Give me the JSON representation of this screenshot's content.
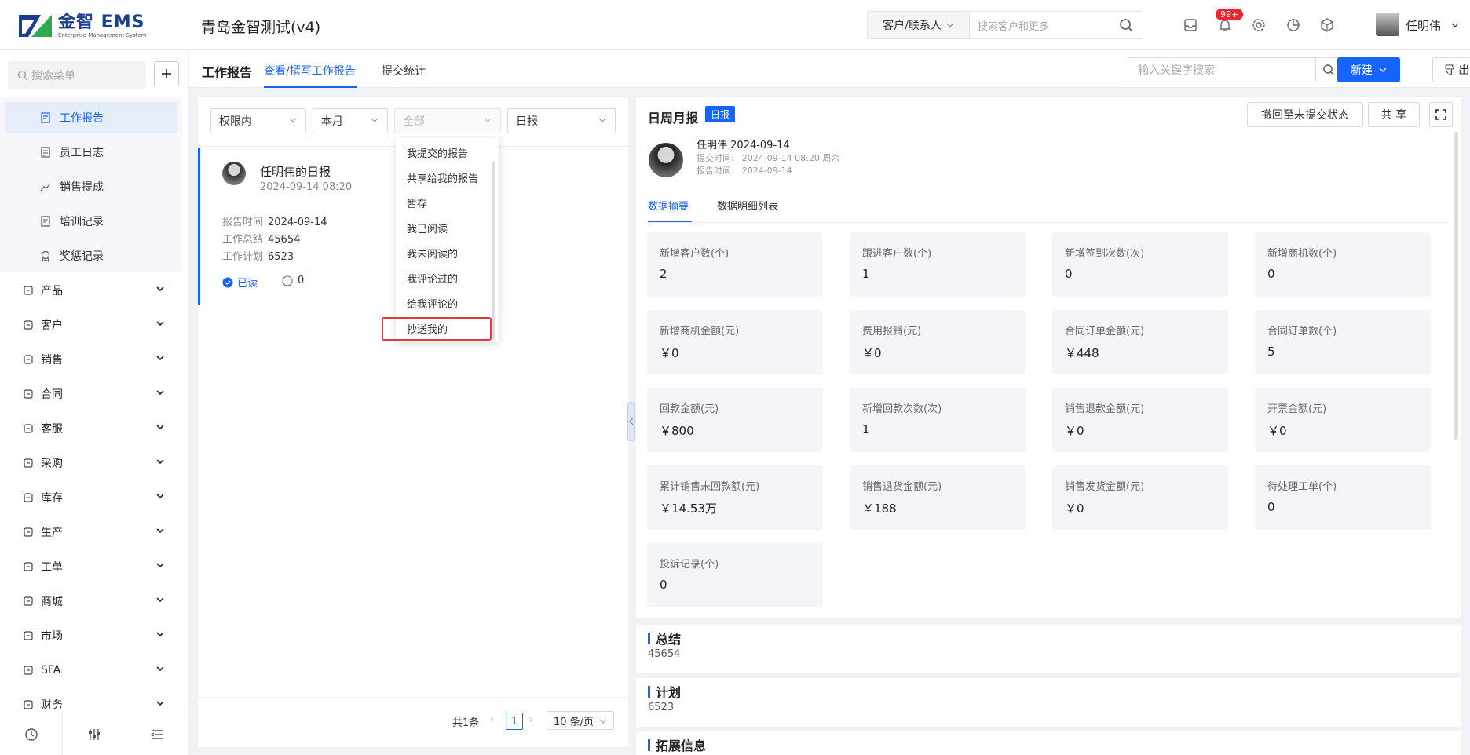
{
  "header": {
    "logo_title": "金智 EMS",
    "logo_sub": "Enterprise Management System",
    "company": "青岛金智测试(v4)",
    "search_scope": "客户/联系人",
    "search_placeholder": "搜索客户和更多",
    "notification_badge": "99+",
    "user_name": "任明伟"
  },
  "sidebar": {
    "search_placeholder": "搜索菜单",
    "sub_items": [
      {
        "label": "工作报告",
        "icon": "report-icon",
        "active": true
      },
      {
        "label": "员工日志",
        "icon": "log-icon"
      },
      {
        "label": "销售提成",
        "icon": "commission-icon"
      },
      {
        "label": "培训记录",
        "icon": "training-icon"
      },
      {
        "label": "奖惩记录",
        "icon": "award-icon"
      }
    ],
    "nav_items": [
      {
        "label": "产品",
        "icon": "product-icon"
      },
      {
        "label": "客户",
        "icon": "customer-icon"
      },
      {
        "label": "销售",
        "icon": "sales-icon"
      },
      {
        "label": "合同",
        "icon": "contract-icon"
      },
      {
        "label": "客服",
        "icon": "service-icon"
      },
      {
        "label": "采购",
        "icon": "purchase-icon"
      },
      {
        "label": "库存",
        "icon": "inventory-icon"
      },
      {
        "label": "生产",
        "icon": "production-icon"
      },
      {
        "label": "工单",
        "icon": "workorder-icon"
      },
      {
        "label": "商城",
        "icon": "mall-icon"
      },
      {
        "label": "市场",
        "icon": "market-icon"
      },
      {
        "label": "SFA",
        "icon": "sfa-icon"
      },
      {
        "label": "财务",
        "icon": "finance-icon"
      }
    ]
  },
  "topbar": {
    "title": "工作报告",
    "tabs": [
      {
        "label": "查看/撰写工作报告",
        "active": true
      },
      {
        "label": "提交统计",
        "active": false
      }
    ],
    "keyword_placeholder": "输入关键字搜索",
    "new_label": "新建",
    "export_label": "导 出"
  },
  "filters": {
    "scope": "权限内",
    "period": "本月",
    "status": "全部",
    "type": "日报"
  },
  "dropdown": {
    "options": [
      "我提交的报告",
      "共享给我的报告",
      "暂存",
      "我已阅读",
      "我未阅读的",
      "我评论过的",
      "给我评论的",
      "抄送我的"
    ],
    "highlighted": "抄送我的"
  },
  "report_card": {
    "title": "任明伟的日报",
    "time": "2024-09-14 08:20",
    "fields": [
      {
        "key": "报告时间",
        "value": "2024-09-14"
      },
      {
        "key": "工作总结",
        "value": "45654"
      },
      {
        "key": "工作计划",
        "value": "6523"
      }
    ],
    "read_status": "已读",
    "comments": "0"
  },
  "pagination": {
    "total": "共1条",
    "page": "1",
    "page_size": "10 条/页"
  },
  "detail": {
    "title": "日周月报",
    "tag": "日报",
    "revert_label": "撤回至未提交状态",
    "share_label": "共 享",
    "user_line": "任明伟 2024-09-14",
    "submit_label": "提交时间:",
    "submit_value": "2024-09-14 08:20 周六",
    "report_label": "报告时间:",
    "report_value": "2024-09-14",
    "tabs": [
      {
        "label": "数据摘要",
        "active": true
      },
      {
        "label": "数据明细列表",
        "active": false
      }
    ],
    "stats": [
      {
        "label": "新增客户数(个)",
        "value": "2"
      },
      {
        "label": "跟进客户数(个)",
        "value": "1"
      },
      {
        "label": "新增签到次数(次)",
        "value": "0"
      },
      {
        "label": "新增商机数(个)",
        "value": "0"
      },
      {
        "label": "新增商机金额(元)",
        "value": "￥0"
      },
      {
        "label": "费用报销(元)",
        "value": "￥0"
      },
      {
        "label": "合同订单金额(元)",
        "value": "￥448"
      },
      {
        "label": "合同订单数(个)",
        "value": "5"
      },
      {
        "label": "回款金额(元)",
        "value": "￥800"
      },
      {
        "label": "新增回款次数(次)",
        "value": "1"
      },
      {
        "label": "销售退款金额(元)",
        "value": "￥0"
      },
      {
        "label": "开票金额(元)",
        "value": "￥0"
      },
      {
        "label": "累计销售未回款额(元)",
        "value": "￥14.53万"
      },
      {
        "label": "销售退货金额(元)",
        "value": "￥188"
      },
      {
        "label": "销售发货金额(元)",
        "value": "￥0"
      },
      {
        "label": "待处理工单(个)",
        "value": "0"
      },
      {
        "label": "投诉记录(个)",
        "value": "0"
      }
    ],
    "summary_title": "总结",
    "summary_text": "45654",
    "plan_title": "计划",
    "plan_text": "6523",
    "ext_title": "拓展信息"
  },
  "colors": {
    "accent": "#1664ff",
    "highlight_border": "#e5383b",
    "badge": "#f5222d"
  }
}
